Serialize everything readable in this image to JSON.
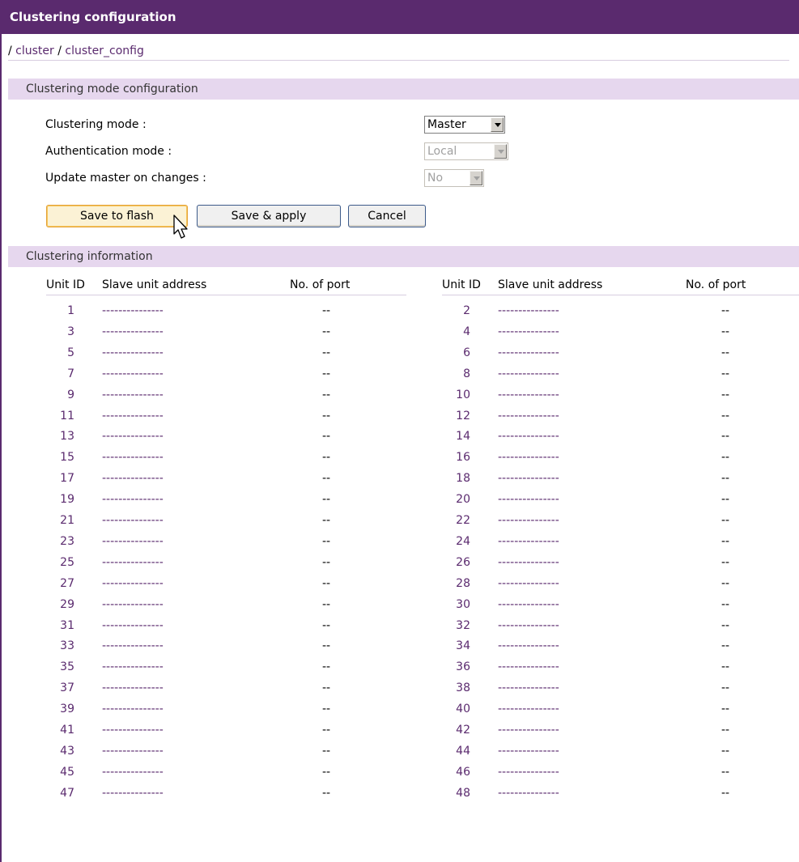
{
  "title": "Clustering configuration",
  "breadcrumb": {
    "sep": "/",
    "items": [
      "cluster",
      "cluster_config"
    ]
  },
  "mode_section": {
    "heading": "Clustering mode configuration",
    "fields": [
      {
        "label": "Clustering mode :",
        "value": "Master",
        "disabled": false
      },
      {
        "label": "Authentication mode :",
        "value": "Local",
        "disabled": true
      },
      {
        "label": "Update master on changes :",
        "value": "No",
        "disabled": true
      }
    ],
    "buttons": {
      "save_flash": "Save to flash",
      "save_apply": "Save & apply",
      "cancel": "Cancel"
    }
  },
  "info_section": {
    "heading": "Clustering information",
    "columns": [
      "Unit ID",
      "Slave unit address",
      "No. of port"
    ],
    "empty_address": "---------------",
    "empty_port": "--",
    "unit_ids": [
      1,
      2,
      3,
      4,
      5,
      6,
      7,
      8,
      9,
      10,
      11,
      12,
      13,
      14,
      15,
      16,
      17,
      18,
      19,
      20,
      21,
      22,
      23,
      24,
      25,
      26,
      27,
      28,
      29,
      30,
      31,
      32,
      33,
      34,
      35,
      36,
      37,
      38,
      39,
      40,
      41,
      42,
      43,
      44,
      45,
      46,
      47,
      48
    ]
  },
  "colors": {
    "accent": "#5a2a6e",
    "section_bg": "#e6d7ee"
  },
  "icons": {
    "dropdown": "chevron-down-icon",
    "cursor": "mouse-pointer-icon"
  }
}
